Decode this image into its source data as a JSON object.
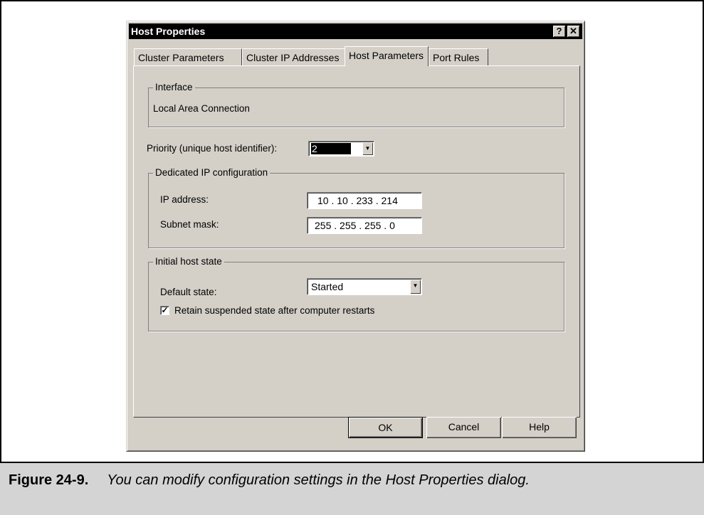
{
  "dialog": {
    "title": "Host Properties",
    "help_button": "?",
    "close_button": "✕"
  },
  "tabs": [
    {
      "label": "Cluster Parameters",
      "active": false
    },
    {
      "label": "Cluster IP Addresses",
      "active": false
    },
    {
      "label": "Host Parameters",
      "active": true
    },
    {
      "label": "Port Rules",
      "active": false
    }
  ],
  "interface_group": {
    "legend": "Interface",
    "value": "Local Area Connection"
  },
  "priority": {
    "label": "Priority (unique host identifier):",
    "value": "2"
  },
  "dedicated_ip": {
    "legend": "Dedicated IP configuration",
    "ip_label": "IP address:",
    "ip_value": "10 . 10 . 233 . 214",
    "mask_label": "Subnet mask:",
    "mask_value": "255 . 255 . 255 .  0"
  },
  "initial_state": {
    "legend": "Initial host state",
    "default_label": "Default state:",
    "default_value": "Started",
    "retain_label": "Retain suspended state after computer restarts",
    "retain_checked": true
  },
  "buttons": {
    "ok": "OK",
    "cancel": "Cancel",
    "help": "Help"
  },
  "caption": {
    "label": "Figure 24-9.",
    "text": "You can modify configuration settings in the Host Properties dialog."
  }
}
